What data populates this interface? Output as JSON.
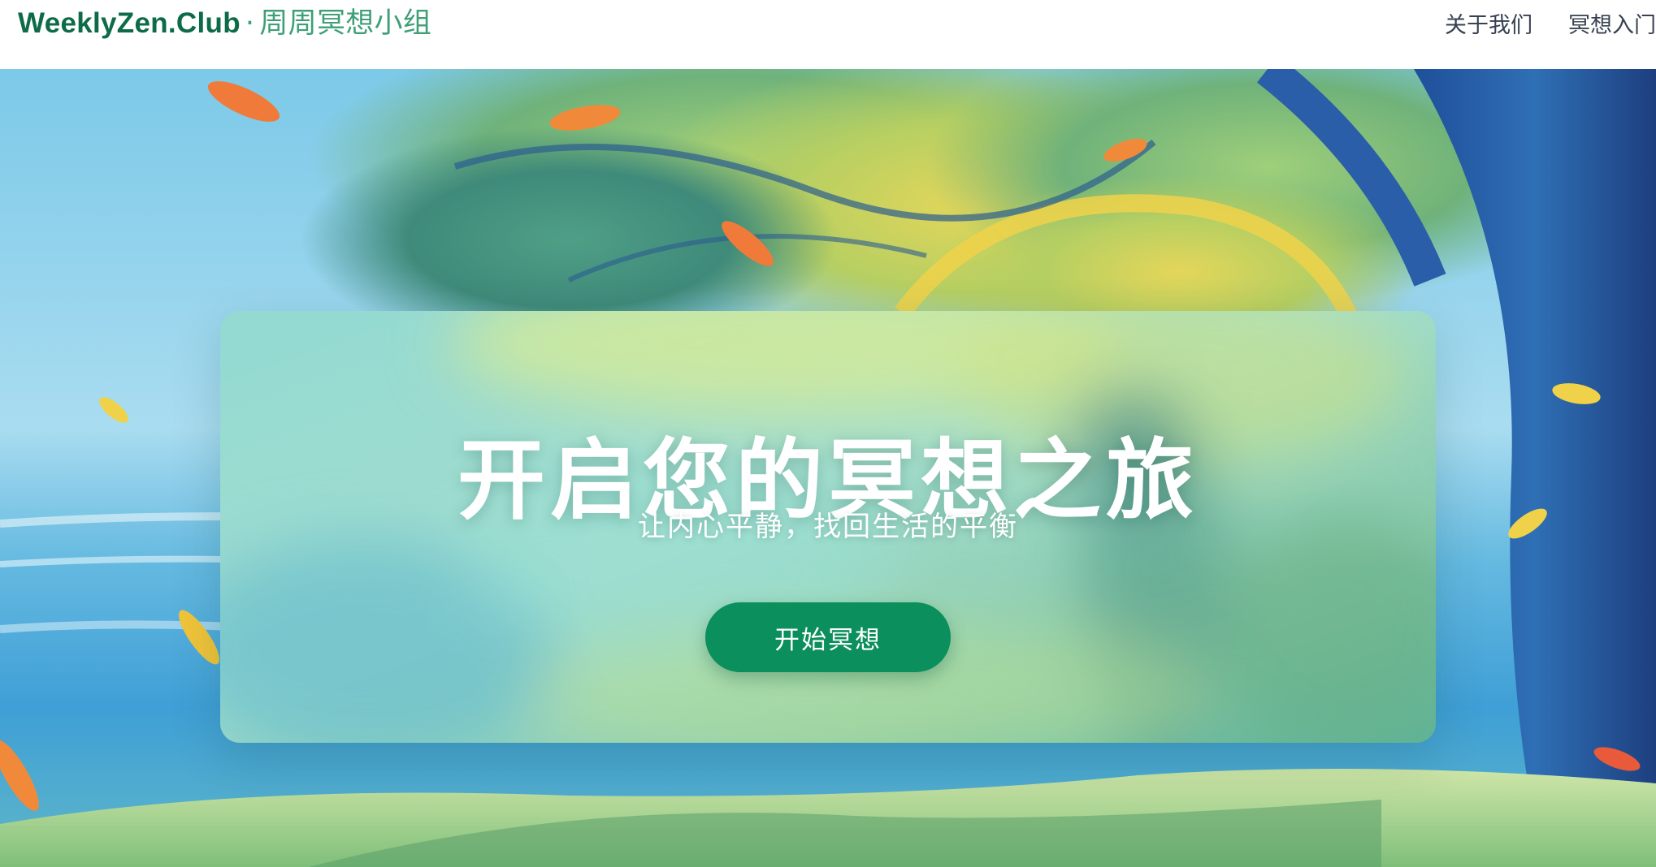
{
  "header": {
    "brand": "WeeklyZen.Club",
    "separator": "·",
    "subtitle": "周周冥想小组",
    "nav": {
      "about": "关于我们",
      "intro": "冥想入门"
    }
  },
  "hero": {
    "title": "开启您的冥想之旅",
    "subtitle": "让内心平静，找回生活的平衡",
    "cta_label": "开始冥想",
    "background_image_alt": "painted illustration of a person meditating under a tree by the sea"
  },
  "colors": {
    "brand_green": "#0d6b49",
    "brand_green_light": "#3f9f76",
    "cta_green": "#0b8f5c",
    "nav_text": "#374151",
    "hero_text": "#ffffff"
  },
  "icons": []
}
